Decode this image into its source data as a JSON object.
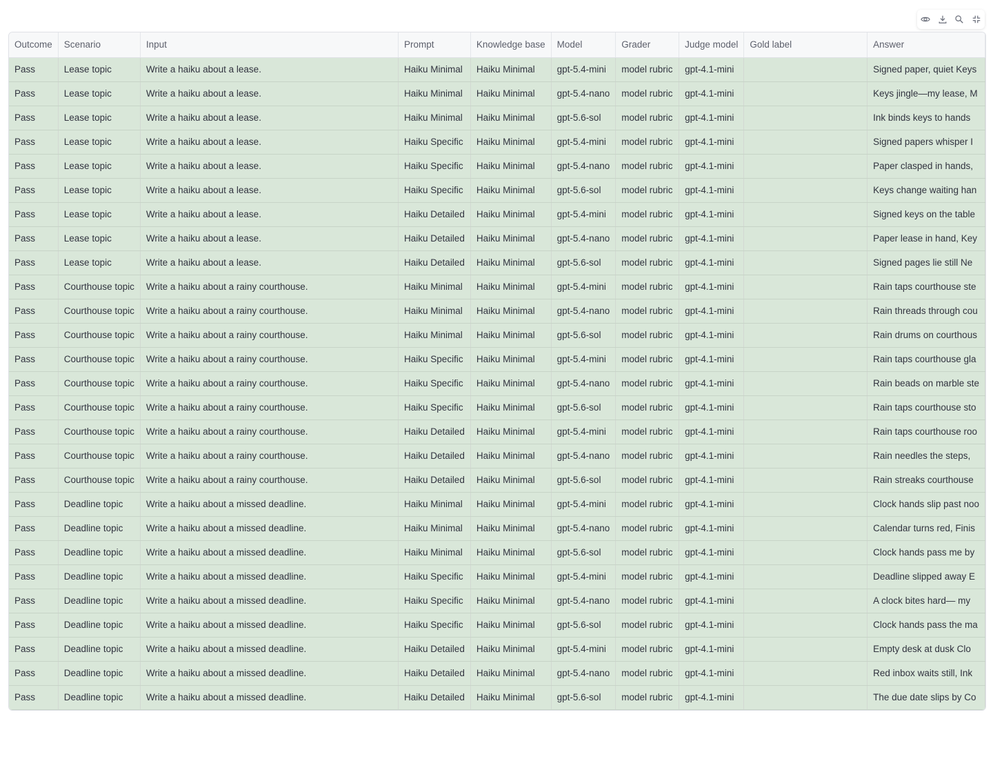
{
  "toolbar": {
    "icons": [
      "eye-icon",
      "download-icon",
      "search-icon",
      "fullscreen-icon"
    ]
  },
  "columns": [
    "Outcome",
    "Scenario",
    "Input",
    "Prompt",
    "Knowledge base",
    "Model",
    "Grader",
    "Judge model",
    "Gold label",
    "Answer"
  ],
  "rows": [
    [
      "Pass",
      "Lease topic",
      "Write a haiku about a lease.",
      "Haiku Minimal",
      "Haiku Minimal",
      "gpt-5.4-mini",
      "model rubric",
      "gpt-4.1-mini",
      "",
      "Signed paper, quiet Keys"
    ],
    [
      "Pass",
      "Lease topic",
      "Write a haiku about a lease.",
      "Haiku Minimal",
      "Haiku Minimal",
      "gpt-5.4-nano",
      "model rubric",
      "gpt-4.1-mini",
      "",
      "Keys jingle—my lease,   M"
    ],
    [
      "Pass",
      "Lease topic",
      "Write a haiku about a lease.",
      "Haiku Minimal",
      "Haiku Minimal",
      "gpt-5.6-sol",
      "model rubric",
      "gpt-4.1-mini",
      "",
      "Ink binds keys to hands"
    ],
    [
      "Pass",
      "Lease topic",
      "Write a haiku about a lease.",
      "Haiku Specific",
      "Haiku Minimal",
      "gpt-5.4-mini",
      "model rubric",
      "gpt-4.1-mini",
      "",
      "Signed papers whisper   I"
    ],
    [
      "Pass",
      "Lease topic",
      "Write a haiku about a lease.",
      "Haiku Specific",
      "Haiku Minimal",
      "gpt-5.4-nano",
      "model rubric",
      "gpt-4.1-mini",
      "",
      "Paper clasped in hands,"
    ],
    [
      "Pass",
      "Lease topic",
      "Write a haiku about a lease.",
      "Haiku Specific",
      "Haiku Minimal",
      "gpt-5.6-sol",
      "model rubric",
      "gpt-4.1-mini",
      "",
      "Keys change waiting han"
    ],
    [
      "Pass",
      "Lease topic",
      "Write a haiku about a lease.",
      "Haiku Detailed",
      "Haiku Minimal",
      "gpt-5.4-mini",
      "model rubric",
      "gpt-4.1-mini",
      "",
      "Signed keys on the table"
    ],
    [
      "Pass",
      "Lease topic",
      "Write a haiku about a lease.",
      "Haiku Detailed",
      "Haiku Minimal",
      "gpt-5.4-nano",
      "model rubric",
      "gpt-4.1-mini",
      "",
      "Paper lease in hand,   Key"
    ],
    [
      "Pass",
      "Lease topic",
      "Write a haiku about a lease.",
      "Haiku Detailed",
      "Haiku Minimal",
      "gpt-5.6-sol",
      "model rubric",
      "gpt-4.1-mini",
      "",
      "Signed pages lie still   Ne"
    ],
    [
      "Pass",
      "Courthouse topic",
      "Write a haiku about a rainy courthouse.",
      "Haiku Minimal",
      "Haiku Minimal",
      "gpt-5.4-mini",
      "model rubric",
      "gpt-4.1-mini",
      "",
      "Rain taps courthouse ste"
    ],
    [
      "Pass",
      "Courthouse topic",
      "Write a haiku about a rainy courthouse.",
      "Haiku Minimal",
      "Haiku Minimal",
      "gpt-5.4-nano",
      "model rubric",
      "gpt-4.1-mini",
      "",
      "Rain threads through cou"
    ],
    [
      "Pass",
      "Courthouse topic",
      "Write a haiku about a rainy courthouse.",
      "Haiku Minimal",
      "Haiku Minimal",
      "gpt-5.6-sol",
      "model rubric",
      "gpt-4.1-mini",
      "",
      "Rain drums on courthous"
    ],
    [
      "Pass",
      "Courthouse topic",
      "Write a haiku about a rainy courthouse.",
      "Haiku Specific",
      "Haiku Minimal",
      "gpt-5.4-mini",
      "model rubric",
      "gpt-4.1-mini",
      "",
      "Rain taps courthouse gla"
    ],
    [
      "Pass",
      "Courthouse topic",
      "Write a haiku about a rainy courthouse.",
      "Haiku Specific",
      "Haiku Minimal",
      "gpt-5.4-nano",
      "model rubric",
      "gpt-4.1-mini",
      "",
      "Rain beads on marble ste"
    ],
    [
      "Pass",
      "Courthouse topic",
      "Write a haiku about a rainy courthouse.",
      "Haiku Specific",
      "Haiku Minimal",
      "gpt-5.6-sol",
      "model rubric",
      "gpt-4.1-mini",
      "",
      "Rain taps courthouse sto"
    ],
    [
      "Pass",
      "Courthouse topic",
      "Write a haiku about a rainy courthouse.",
      "Haiku Detailed",
      "Haiku Minimal",
      "gpt-5.4-mini",
      "model rubric",
      "gpt-4.1-mini",
      "",
      "Rain taps courthouse roo"
    ],
    [
      "Pass",
      "Courthouse topic",
      "Write a haiku about a rainy courthouse.",
      "Haiku Detailed",
      "Haiku Minimal",
      "gpt-5.4-nano",
      "model rubric",
      "gpt-4.1-mini",
      "",
      "Rain needles the steps,"
    ],
    [
      "Pass",
      "Courthouse topic",
      "Write a haiku about a rainy courthouse.",
      "Haiku Detailed",
      "Haiku Minimal",
      "gpt-5.6-sol",
      "model rubric",
      "gpt-4.1-mini",
      "",
      "Rain streaks courthouse"
    ],
    [
      "Pass",
      "Deadline topic",
      "Write a haiku about a missed deadline.",
      "Haiku Minimal",
      "Haiku Minimal",
      "gpt-5.4-mini",
      "model rubric",
      "gpt-4.1-mini",
      "",
      "Clock hands slip past noo"
    ],
    [
      "Pass",
      "Deadline topic",
      "Write a haiku about a missed deadline.",
      "Haiku Minimal",
      "Haiku Minimal",
      "gpt-5.4-nano",
      "model rubric",
      "gpt-4.1-mini",
      "",
      "Calendar turns red,   Finis"
    ],
    [
      "Pass",
      "Deadline topic",
      "Write a haiku about a missed deadline.",
      "Haiku Minimal",
      "Haiku Minimal",
      "gpt-5.6-sol",
      "model rubric",
      "gpt-4.1-mini",
      "",
      "Clock hands pass me by"
    ],
    [
      "Pass",
      "Deadline topic",
      "Write a haiku about a missed deadline.",
      "Haiku Specific",
      "Haiku Minimal",
      "gpt-5.4-mini",
      "model rubric",
      "gpt-4.1-mini",
      "",
      "Deadline slipped away   E"
    ],
    [
      "Pass",
      "Deadline topic",
      "Write a haiku about a missed deadline.",
      "Haiku Specific",
      "Haiku Minimal",
      "gpt-5.4-nano",
      "model rubric",
      "gpt-4.1-mini",
      "",
      "A clock bites hard—   my"
    ],
    [
      "Pass",
      "Deadline topic",
      "Write a haiku about a missed deadline.",
      "Haiku Specific",
      "Haiku Minimal",
      "gpt-5.6-sol",
      "model rubric",
      "gpt-4.1-mini",
      "",
      "Clock hands pass the ma"
    ],
    [
      "Pass",
      "Deadline topic",
      "Write a haiku about a missed deadline.",
      "Haiku Detailed",
      "Haiku Minimal",
      "gpt-5.4-mini",
      "model rubric",
      "gpt-4.1-mini",
      "",
      "Empty desk at dusk   Clo"
    ],
    [
      "Pass",
      "Deadline topic",
      "Write a haiku about a missed deadline.",
      "Haiku Detailed",
      "Haiku Minimal",
      "gpt-5.4-nano",
      "model rubric",
      "gpt-4.1-mini",
      "",
      "Red inbox waits still,   Ink"
    ],
    [
      "Pass",
      "Deadline topic",
      "Write a haiku about a missed deadline.",
      "Haiku Detailed",
      "Haiku Minimal",
      "gpt-5.6-sol",
      "model rubric",
      "gpt-4.1-mini",
      "",
      "The due date slips by   Co"
    ]
  ]
}
